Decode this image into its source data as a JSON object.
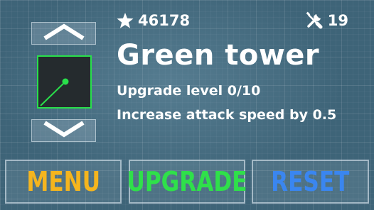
{
  "header": {
    "stars_value": "46178",
    "stars_icon": "star-icon",
    "tools_value": "19",
    "tools_icon": "crossed-tools-icon"
  },
  "tower": {
    "name": "Green tower",
    "upgrade_level_text": "Upgrade level 0/10",
    "upgrade_effect_text": "Increase attack speed by 0.5",
    "color": "#29e04b"
  },
  "selector": {
    "up_icon": "chevron-up-icon",
    "down_icon": "chevron-down-icon"
  },
  "buttons": {
    "menu_label": "MENU",
    "menu_color": "#f5b51e",
    "upgrade_label": "UPGRADE",
    "upgrade_color": "#2fe04a",
    "reset_label": "RESET",
    "reset_color": "#3a86f0"
  }
}
